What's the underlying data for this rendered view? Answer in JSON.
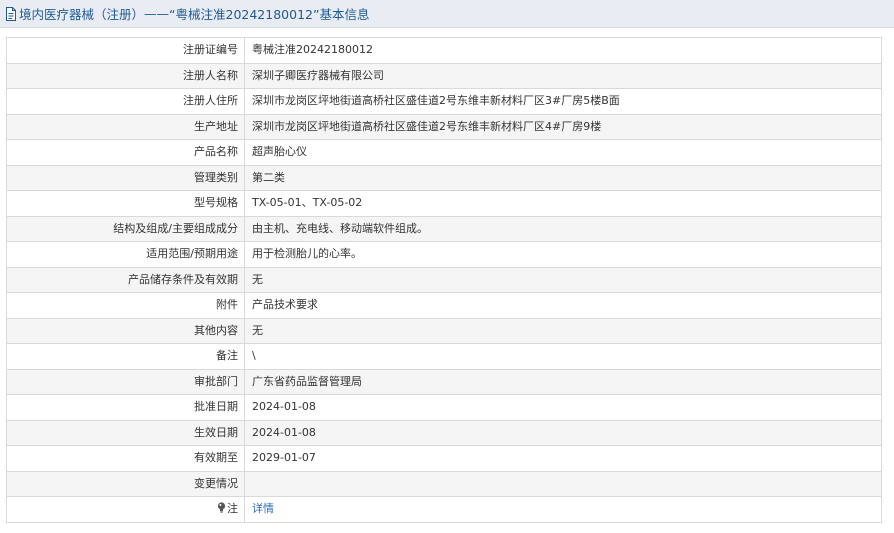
{
  "header": {
    "category": "境内医疗器械（注册）",
    "separator": " —— ",
    "title": "“粤械注准20242180012”基本信息"
  },
  "rows": [
    {
      "label": "注册证编号",
      "value": "粤械注准20242180012"
    },
    {
      "label": "注册人名称",
      "value": "深圳子卿医疗器械有限公司"
    },
    {
      "label": "注册人住所",
      "value": "深圳市龙岗区坪地街道高桥社区盛佳道2号东维丰新材料厂区3#厂房5楼B面"
    },
    {
      "label": "生产地址",
      "value": "深圳市龙岗区坪地街道高桥社区盛佳道2号东维丰新材料厂区4#厂房9楼"
    },
    {
      "label": "产品名称",
      "value": "超声胎心仪"
    },
    {
      "label": "管理类别",
      "value": "第二类"
    },
    {
      "label": "型号规格",
      "value": "TX-05-01、TX-05-02"
    },
    {
      "label": "结构及组成/主要组成成分",
      "value": "由主机、充电线、移动端软件组成。"
    },
    {
      "label": "适用范围/预期用途",
      "value": "用于检测胎儿的心率。"
    },
    {
      "label": "产品储存条件及有效期",
      "value": "无"
    },
    {
      "label": "附件",
      "value": "产品技术要求"
    },
    {
      "label": "其他内容",
      "value": "无"
    },
    {
      "label": "备注",
      "value": "\\"
    },
    {
      "label": "审批部门",
      "value": "广东省药品监督管理局"
    },
    {
      "label": "批准日期",
      "value": "2024-01-08"
    },
    {
      "label": "生效日期",
      "value": "2024-01-08"
    },
    {
      "label": "有效期至",
      "value": "2029-01-07"
    },
    {
      "label": "变更情况",
      "value": ""
    }
  ],
  "note": {
    "label": "注",
    "link_text": "详情",
    "icon": "bulb-icon"
  },
  "colors": {
    "title": "#1d5a96",
    "header_bg": "#e9edf3",
    "alt_row_bg": "#f5f5f5",
    "border": "#d9d9d9",
    "link": "#2a6ebf"
  }
}
